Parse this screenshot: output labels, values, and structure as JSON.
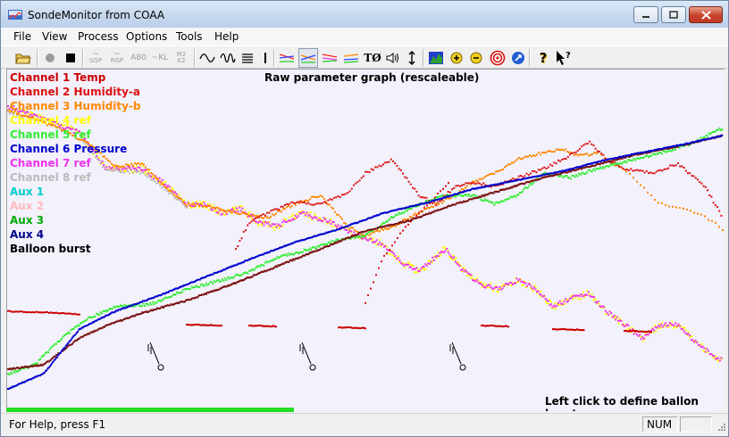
{
  "window": {
    "title": "SondeMonitor from COAA"
  },
  "menu": [
    "File",
    "View",
    "Process",
    "Options",
    "Tools",
    "Help"
  ],
  "toolbar": {
    "sgp": "SGP",
    "rgp": "RGP",
    "a80": "80",
    "kl": "KL",
    "m2": "M2",
    "k2": "K2",
    "icons": [
      "open-folder-icon",
      "record-icon",
      "stop-icon",
      "sgp-icon",
      "rgp-icon",
      "a80-icon",
      "kl-icon",
      "m2k2-icon",
      "wave-icon",
      "double-wave-icon",
      "lines-icon",
      "bar-icon",
      "graph-1-icon",
      "graph-2-icon",
      "graph-3-icon",
      "graph-4-icon",
      "t-phi-icon",
      "speaker-icon",
      "vertical-arrows-icon",
      "map-icon",
      "zoom-in-icon",
      "zoom-out-icon",
      "target-icon",
      "compass-icon",
      "help-icon",
      "context-help-icon"
    ]
  },
  "graph": {
    "title": "Raw parameter graph (rescaleable)",
    "hint": "Left click to define ballon burst",
    "legend": [
      {
        "label": "Channel 1 Temp",
        "color": "#cc0000"
      },
      {
        "label": "Channel 2 Humidity-a",
        "color": "#dd1111"
      },
      {
        "label": "Channel 3 Humidity-b",
        "color": "#ff8800"
      },
      {
        "label": "Channel 4 ref",
        "color": "#ffff00"
      },
      {
        "label": "Channel 5 ref",
        "color": "#33ee33"
      },
      {
        "label": "Channel 6 Pressure",
        "color": "#0000cc"
      },
      {
        "label": "Channel 7 ref",
        "color": "#ee33ee"
      },
      {
        "label": "Channel 8 ref",
        "color": "#bbbbbb"
      },
      {
        "label": "Aux 1",
        "color": "#00cccc"
      },
      {
        "label": "Aux 2",
        "color": "#ffbbbb"
      },
      {
        "label": "Aux 3",
        "color": "#00aa00"
      },
      {
        "label": "Aux 4",
        "color": "#000088"
      },
      {
        "label": "Balloon burst",
        "color": "#000000"
      }
    ],
    "progress": 0.4
  },
  "status": {
    "help": "For Help, press F1",
    "num": "NUM"
  }
}
